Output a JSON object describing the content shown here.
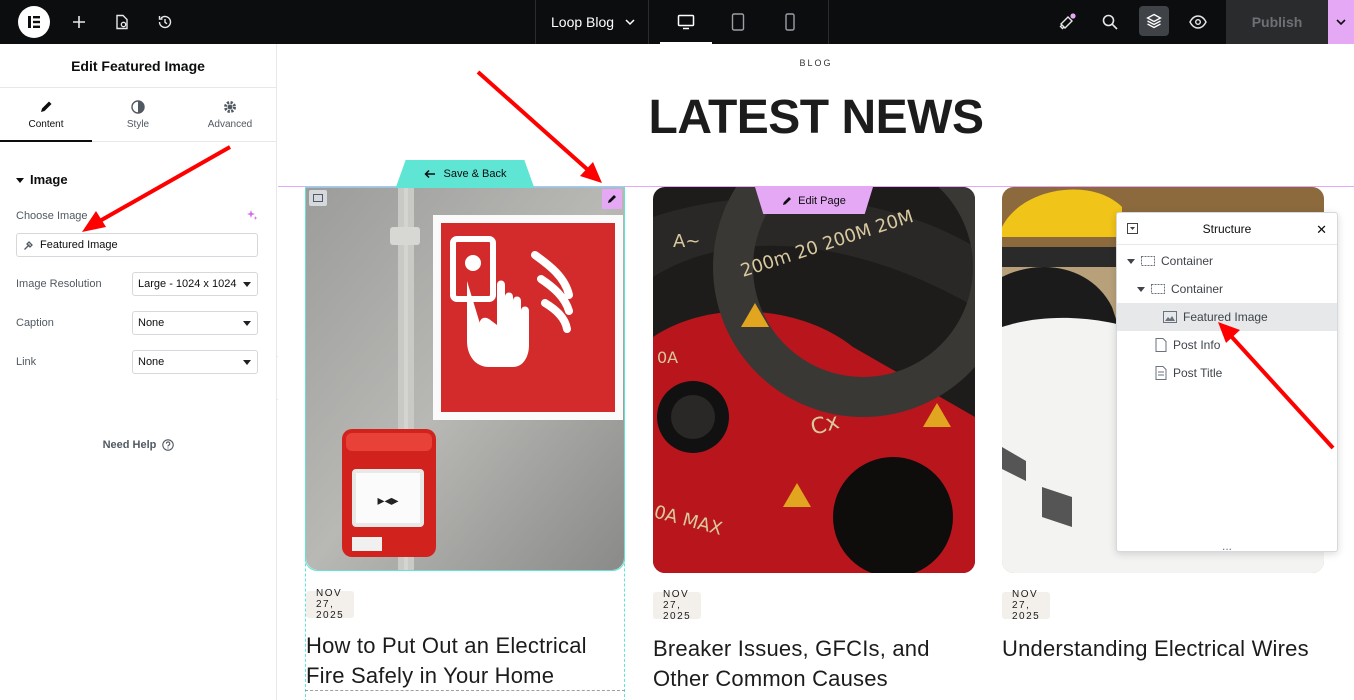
{
  "topbar": {
    "document_title": "Loop Blog",
    "publish_label": "Publish",
    "icons": [
      "elementor-logo",
      "add-icon",
      "page-settings-icon",
      "history-icon",
      "desktop-icon",
      "tablet-icon",
      "mobile-icon",
      "notifications-icon",
      "search-icon",
      "structure-layers-icon",
      "preview-eye-icon",
      "chevron-down-icon"
    ]
  },
  "panel": {
    "title": "Edit Featured Image",
    "tabs": [
      {
        "label": "Content",
        "icon": "pencil-icon"
      },
      {
        "label": "Style",
        "icon": "contrast-icon"
      },
      {
        "label": "Advanced",
        "icon": "gear-icon"
      }
    ],
    "section_title": "Image",
    "choose_image_label": "Choose Image",
    "choose_image_value": "Featured Image",
    "image_resolution_label": "Image Resolution",
    "image_resolution_value": "Large - 1024 x 1024",
    "caption_label": "Caption",
    "caption_value": "None",
    "link_label": "Link",
    "link_value": "None",
    "need_help": "Need Help"
  },
  "canvas": {
    "eyebrow": "BLOG",
    "headline": "LATEST NEWS",
    "save_back": "Save & Back",
    "edit_page": "Edit Page",
    "cards": [
      {
        "date": "NOV 27, 2025",
        "title_line1": "How to Put Out an Electrical",
        "title_line2": "Fire Safely in Your Home"
      },
      {
        "date": "NOV 27, 2025",
        "title_line1": "Breaker Issues, GFCIs, and",
        "title_line2": "Other Common Causes"
      },
      {
        "date": "NOV 27, 2025",
        "title_line1": "Understanding Electrical Wires",
        "title_line2": ""
      }
    ]
  },
  "structure": {
    "title": "Structure",
    "items": [
      {
        "label": "Container",
        "icon": "container-icon"
      },
      {
        "label": "Container",
        "icon": "container-icon"
      },
      {
        "label": "Featured Image",
        "icon": "image-icon"
      },
      {
        "label": "Post Info",
        "icon": "post-info-icon"
      },
      {
        "label": "Post Title",
        "icon": "post-title-icon"
      }
    ],
    "footer": "..."
  },
  "colors": {
    "topbar": "#0c0d0e",
    "accent_pink": "#e5a8f5",
    "accent_teal": "#5ee5d4",
    "annotation_arrow": "#ff0000"
  }
}
